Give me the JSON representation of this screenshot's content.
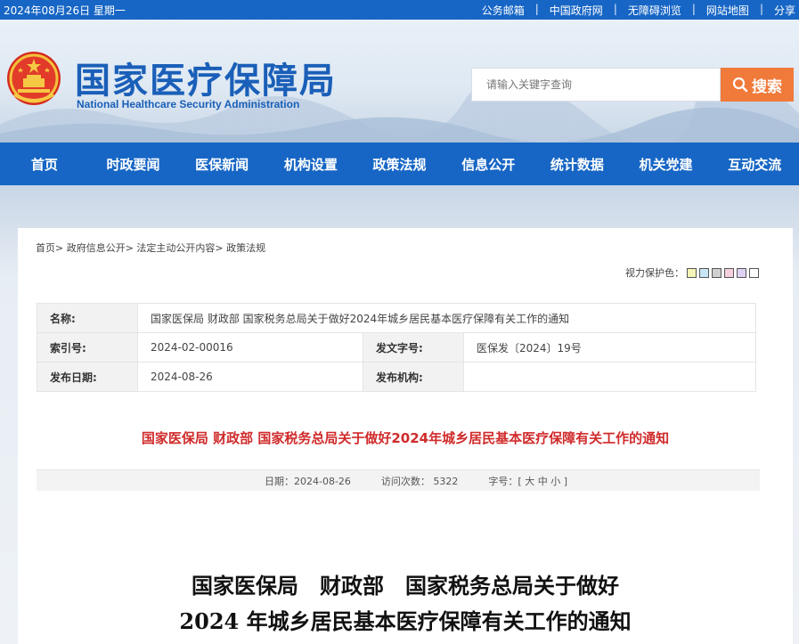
{
  "topbar": {
    "date": "2024年08月26日 星期一",
    "links": [
      "公务邮箱",
      "中国政府网",
      "无障碍浏览",
      "网站地图",
      "分享"
    ],
    "separator": "|"
  },
  "header": {
    "brand_cn": "国家医疗保障局",
    "brand_en": "National Healthcare Security Administration",
    "search_placeholder": "请输入关键字查询",
    "search_label": "搜索",
    "emblem_icon": "national-emblem-icon"
  },
  "nav": [
    "首页",
    "时政要闻",
    "医保新闻",
    "机构设置",
    "政策法规",
    "信息公开",
    "统计数据",
    "机关党建",
    "互动交流"
  ],
  "breadcrumb": "首页> 政府信息公开> 法定主动公开内容> 政策法规",
  "vision": {
    "label": "视力保护色：",
    "colors": [
      "#f5f5b8",
      "#c8e6f5",
      "#d0d0d0",
      "#f5d0e0",
      "#e0d0f5",
      "#ffffff"
    ]
  },
  "meta": {
    "name_label": "名称:",
    "name_value": "国家医保局 财政部 国家税务总局关于做好2024年城乡居民基本医疗保障有关工作的通知",
    "index_label": "索引号:",
    "index_value": "2024-02-00016",
    "docno_label": "发文字号:",
    "docno_value": "医保发〔2024〕19号",
    "date_label": "发布日期:",
    "date_value": "2024-08-26",
    "org_label": "发布机构:",
    "org_value": ""
  },
  "red_title": "国家医保局 财政部 国家税务总局关于做好2024年城乡居民基本医疗保障有关工作的通知",
  "info_bar": {
    "date": "日期：2024-08-26",
    "visits": "访问次数：  5322",
    "font_size": "字号：[ 大 中 小 ]"
  },
  "doc_title": {
    "line1": "国家医保局　财政部　国家税务总局关于做好",
    "line2": "2024 年城乡居民基本医疗保障有关工作的通知"
  }
}
